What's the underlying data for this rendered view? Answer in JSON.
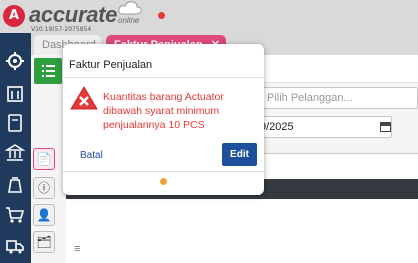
{
  "app": {
    "brand": "accurate",
    "brand_sub": "online",
    "version": "V10.19(57-2075854"
  },
  "tabs": [
    {
      "label": "Dashboard"
    },
    {
      "label": "Faktur Penjualan",
      "close": "✕"
    }
  ],
  "form": {
    "customer_placeholder": "Pilih Pelanggan...",
    "date_value": "9/2025"
  },
  "grid": {
    "menu_icon": "≡",
    "chevron": "⌃"
  },
  "side_tabs": [
    "📄",
    "ⓘ",
    "👤",
    "🗂"
  ],
  "modal": {
    "title": "Faktur Penjualan",
    "message": "Kuantitas barang Actuator dibawah syarat minimum penjualannya 10 PCS",
    "cancel_label": "Batal",
    "edit_label": "Edit"
  },
  "colors": {
    "accent": "#e04a7a",
    "sidebar": "#1f3a5c",
    "warning": "#e53935",
    "primary_button": "#1e4f9c"
  }
}
